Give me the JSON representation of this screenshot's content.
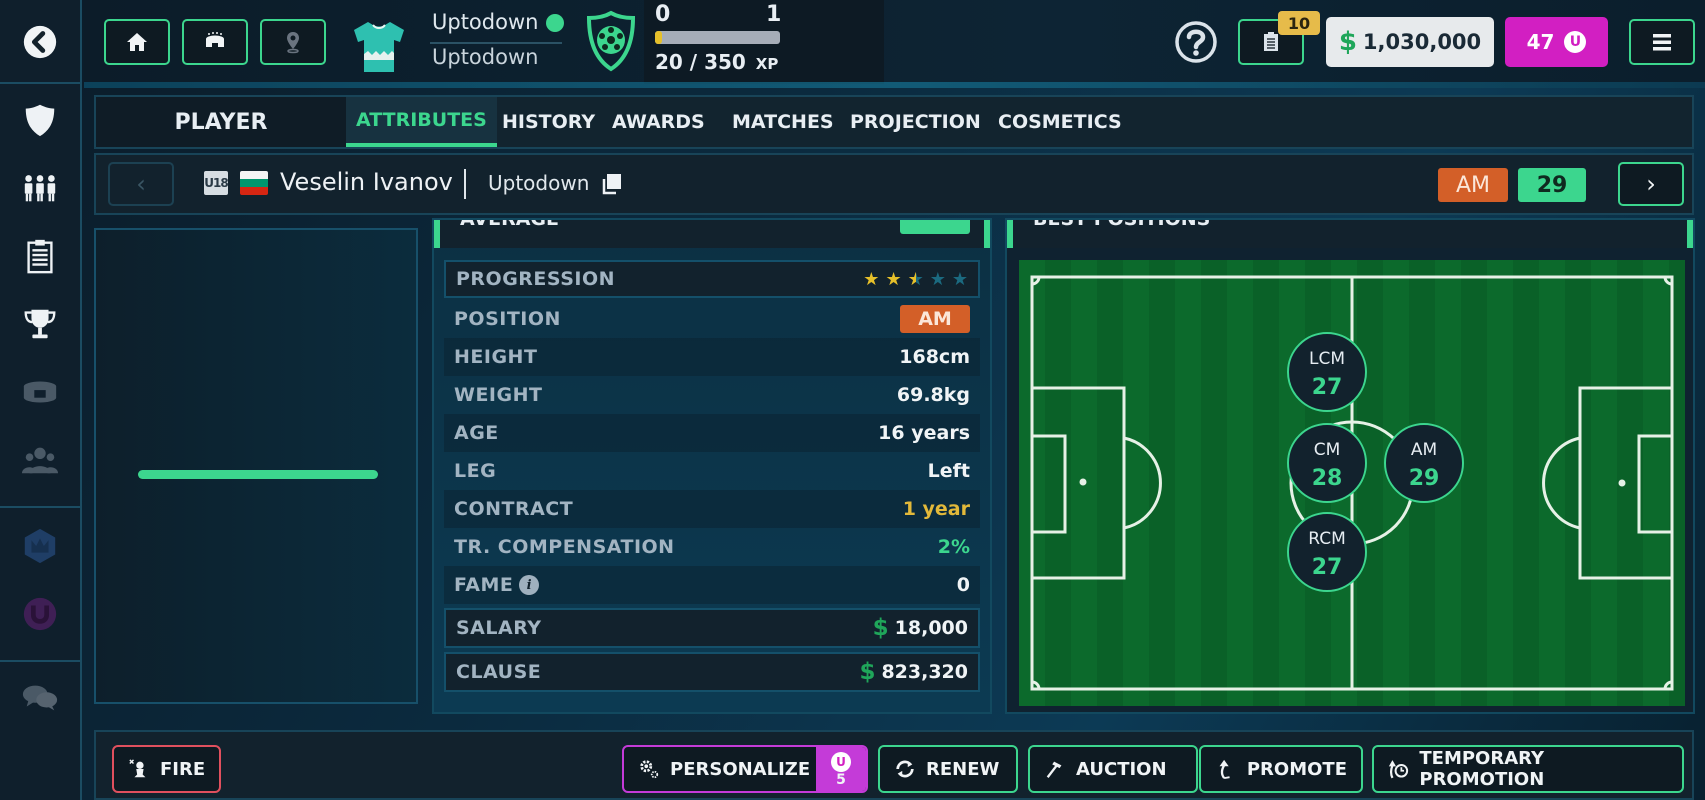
{
  "topbar": {
    "back_icon": "chevron-left-circle-icon",
    "nav_buttons": [
      {
        "name": "home",
        "icon": "home-icon"
      },
      {
        "name": "stadium",
        "icon": "stadium-icon"
      },
      {
        "name": "location",
        "icon": "location-pin-icon"
      }
    ],
    "club_name_primary": "Uptodown",
    "club_name_secondary": "Uptodown",
    "status_color": "#3cd68e",
    "level_from": "0",
    "level_to": "1",
    "xp_text": "20 / 350",
    "xp_unit": "XP",
    "xp_progress": 0.057,
    "help_icon": "question-circle-icon",
    "tasks_badge": "10",
    "money": "1,030,000",
    "money_symbol": "$",
    "gems": "47",
    "menu_icon": "hamburger-icon"
  },
  "sidebar": {
    "items": [
      {
        "name": "club",
        "icon": "shield-icon",
        "active": true
      },
      {
        "name": "squad",
        "icon": "players-icon",
        "active": true
      },
      {
        "name": "tactics",
        "icon": "clipboard-icon",
        "active": true
      },
      {
        "name": "competitions",
        "icon": "trophy-icon",
        "active": true
      },
      {
        "name": "stadium",
        "icon": "stadium-icon",
        "active": false
      },
      {
        "name": "community",
        "icon": "group-icon",
        "active": false
      },
      {
        "name": "league",
        "icon": "crown-hex-icon",
        "active": false
      },
      {
        "name": "ucoins",
        "icon": "u-coin-icon",
        "active": false
      },
      {
        "name": "chat",
        "icon": "chat-bubbles-icon",
        "active": false
      }
    ]
  },
  "tabs": {
    "section_title": "PLAYER",
    "items": [
      {
        "label": "ATTRIBUTES",
        "active": true
      },
      {
        "label": "HISTORY",
        "active": false
      },
      {
        "label": "AWARDS",
        "active": false
      },
      {
        "label": "MATCHES",
        "active": false
      },
      {
        "label": "PROJECTION",
        "active": false
      },
      {
        "label": "COSMETICS",
        "active": false
      }
    ]
  },
  "player": {
    "age_group": "U18",
    "nationality": "Bulgaria",
    "name": "Veselin Ivanov",
    "club": "Uptodown",
    "position": "AM",
    "rating": "29"
  },
  "attributes": {
    "section_title": "AVERAGE",
    "progression_stars": 2.5,
    "progression_max": 5,
    "rows": [
      {
        "label": "PROGRESSION",
        "value": ""
      },
      {
        "label": "POSITION",
        "value": "AM"
      },
      {
        "label": "HEIGHT",
        "value": "168cm"
      },
      {
        "label": "WEIGHT",
        "value": "69.8kg"
      },
      {
        "label": "AGE",
        "value": "16 years"
      },
      {
        "label": "LEG",
        "value": "Left"
      },
      {
        "label": "CONTRACT",
        "value": "1 year"
      },
      {
        "label": "TR. COMPENSATION",
        "value": "2%"
      },
      {
        "label": "FAME",
        "value": "0"
      },
      {
        "label": "SALARY",
        "value": "18,000"
      },
      {
        "label": "CLAUSE",
        "value": "823,320"
      }
    ],
    "colors": {
      "contract": "#e3b93a",
      "compensation": "#3cd68e",
      "money_symbol": "#1fa65a"
    }
  },
  "best_positions": {
    "section_title": "BEST POSITIONS",
    "positions": [
      {
        "code": "LCM",
        "rating": "27"
      },
      {
        "code": "CM",
        "rating": "28"
      },
      {
        "code": "RCM",
        "rating": "27"
      },
      {
        "code": "AM",
        "rating": "29"
      }
    ]
  },
  "actions": {
    "fire": "FIRE",
    "personalize": "PERSONALIZE",
    "personalize_cost": "5",
    "renew": "RENEW",
    "auction": "AUCTION",
    "promote": "PROMOTE",
    "temporary_promotion": "TEMPORARY PROMOTION"
  },
  "colors": {
    "accent": "#3cd68e",
    "danger": "#e0505e",
    "premium": "#c43bd8",
    "position_badge": "#d35f28",
    "gold": "#e6c02a"
  }
}
